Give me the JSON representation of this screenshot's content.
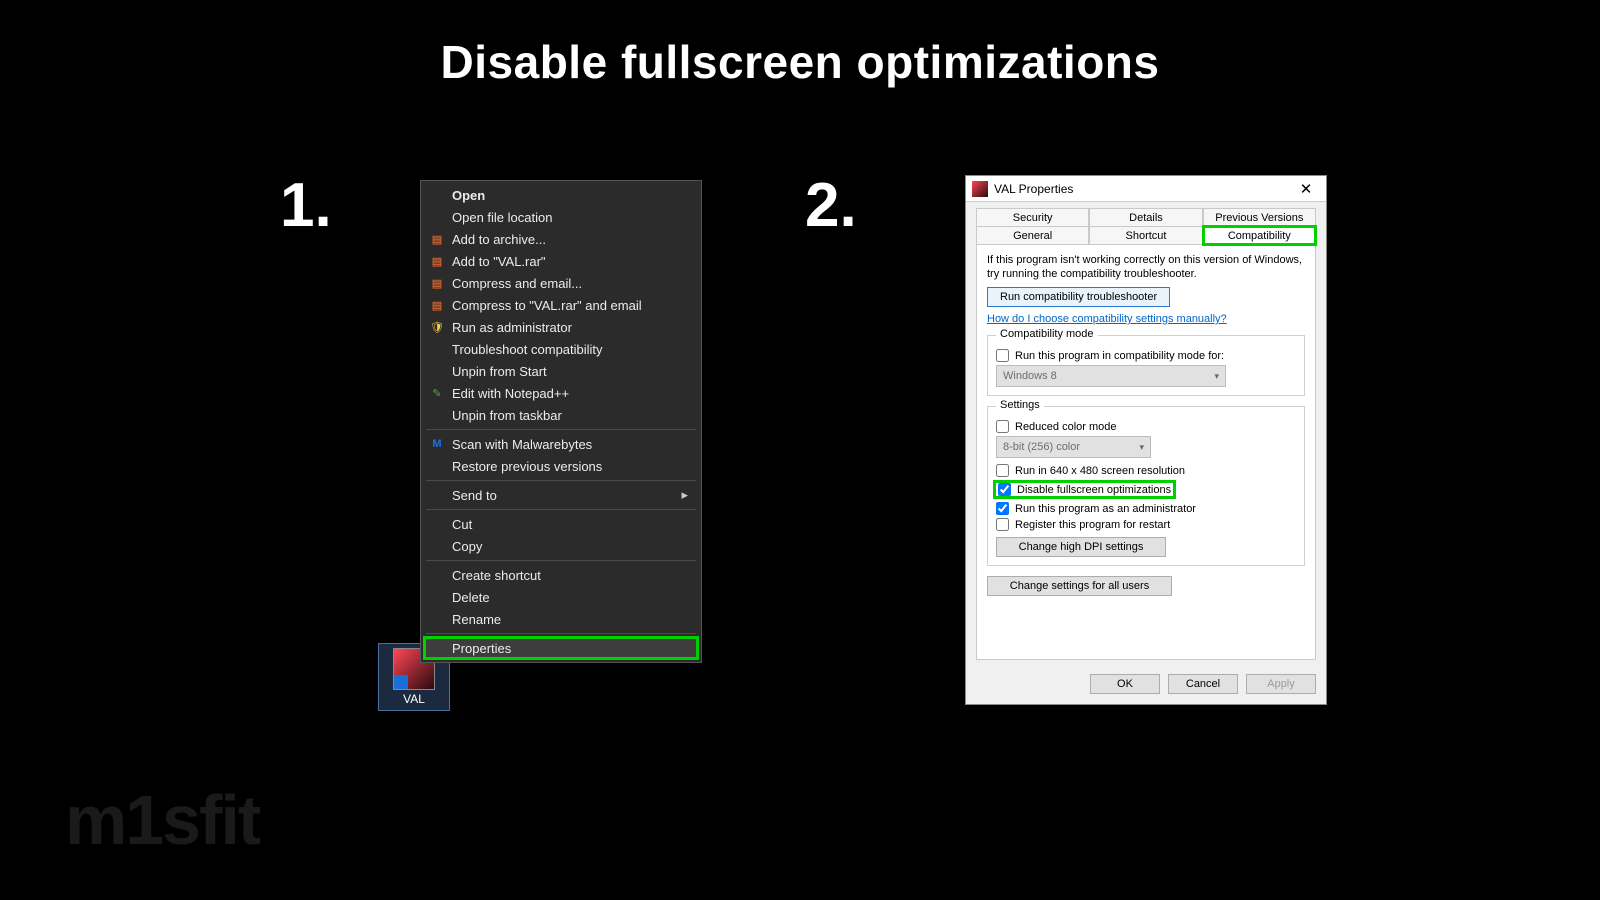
{
  "title": "Disable fullscreen optimizations",
  "step1": "1.",
  "step2": "2.",
  "watermark": "m1sfit",
  "desktop": {
    "label": "VAL"
  },
  "ctx": {
    "open": "Open",
    "open_loc": "Open file location",
    "add_archive": "Add to archive...",
    "add_valrar": "Add to \"VAL.rar\"",
    "compress_email": "Compress and email...",
    "compress_valrar_email": "Compress to \"VAL.rar\" and email",
    "run_admin": "Run as administrator",
    "troubleshoot": "Troubleshoot compatibility",
    "unpin_start": "Unpin from Start",
    "edit_npp": "Edit with Notepad++",
    "unpin_taskbar": "Unpin from taskbar",
    "scan_mwb": "Scan with Malwarebytes",
    "restore_prev": "Restore previous versions",
    "send_to": "Send to",
    "cut": "Cut",
    "copy": "Copy",
    "create_shortcut": "Create shortcut",
    "delete": "Delete",
    "rename": "Rename",
    "properties": "Properties"
  },
  "dialog": {
    "title": "VAL Properties",
    "tabs": {
      "security": "Security",
      "details": "Details",
      "prev_versions": "Previous Versions",
      "general": "General",
      "shortcut": "Shortcut",
      "compatibility": "Compatibility"
    },
    "info": "If this program isn't working correctly on this version of Windows, try running the compatibility troubleshooter.",
    "run_trouble_btn": "Run compatibility troubleshooter",
    "help_link": "How do I choose compatibility settings manually?",
    "compat_mode_legend": "Compatibility mode",
    "compat_mode_chk": "Run this program in compatibility mode for:",
    "compat_mode_sel": "Windows 8",
    "settings_legend": "Settings",
    "reduced_color": "Reduced color mode",
    "color_sel": "8-bit (256) color",
    "run_640": "Run in 640 x 480 screen resolution",
    "disable_fs": "Disable fullscreen optimizations",
    "run_admin": "Run this program as an administrator",
    "register_restart": "Register this program for restart",
    "change_dpi": "Change high DPI settings",
    "change_all": "Change settings for all users",
    "ok": "OK",
    "cancel": "Cancel",
    "apply": "Apply"
  }
}
